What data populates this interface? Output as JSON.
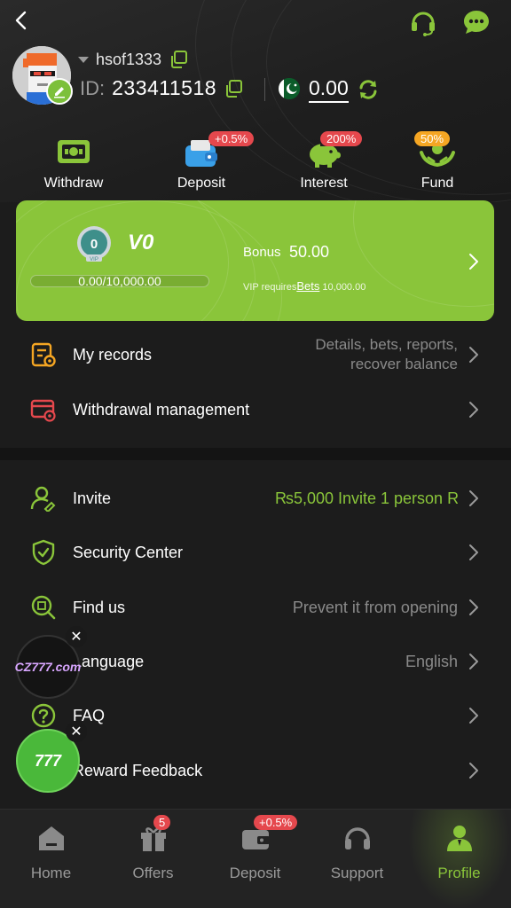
{
  "header": {
    "username": "hsof1333",
    "id_label": "ID:",
    "id_value": "233411518",
    "balance": "0.00"
  },
  "quick_actions": [
    {
      "label": "Withdraw",
      "badge": ""
    },
    {
      "label": "Deposit",
      "badge": "+0.5%"
    },
    {
      "label": "Interest",
      "badge": "200%"
    },
    {
      "label": "Fund",
      "badge": "50%"
    }
  ],
  "vip": {
    "medal_level": "0",
    "medal_caption": "VIP",
    "level": "V0",
    "progress_text": "0.00/10,000.00",
    "progress_fraction": 0,
    "bonus_label": "Bonus",
    "bonus_value": "50.00",
    "requires_prefix": "VIP requires",
    "requires_link": "Bets",
    "requires_amount": "10,000.00"
  },
  "menu": {
    "records": {
      "label": "My records",
      "hint_line1": "Details, bets, reports,",
      "hint_line2": "recover balance"
    },
    "withdrawal": {
      "label": "Withdrawal management"
    },
    "invite": {
      "label": "Invite",
      "hint": "₨5,000  Invite 1 person R"
    },
    "security": {
      "label": "Security Center"
    },
    "findus": {
      "label": "Find us",
      "hint": "Prevent it from opening"
    },
    "language": {
      "label": "Language",
      "hint": "English"
    },
    "faq": {
      "label": "FAQ"
    },
    "reward": {
      "label": "Reward Feedback"
    }
  },
  "floating": {
    "cz_logo_text": "CZ777.com",
    "wl_logo_text": "777",
    "close_glyph": "✕"
  },
  "bottom_nav": [
    {
      "label": "Home",
      "badge": ""
    },
    {
      "label": "Offers",
      "badge": "5"
    },
    {
      "label": "Deposit",
      "badge": "+0.5%"
    },
    {
      "label": "Support",
      "badge": ""
    },
    {
      "label": "Profile",
      "badge": ""
    }
  ],
  "colors": {
    "accent": "#8ac53a",
    "background": "#1c1c1c",
    "badge_red": "#e5484d",
    "badge_orange": "#f5a623"
  }
}
